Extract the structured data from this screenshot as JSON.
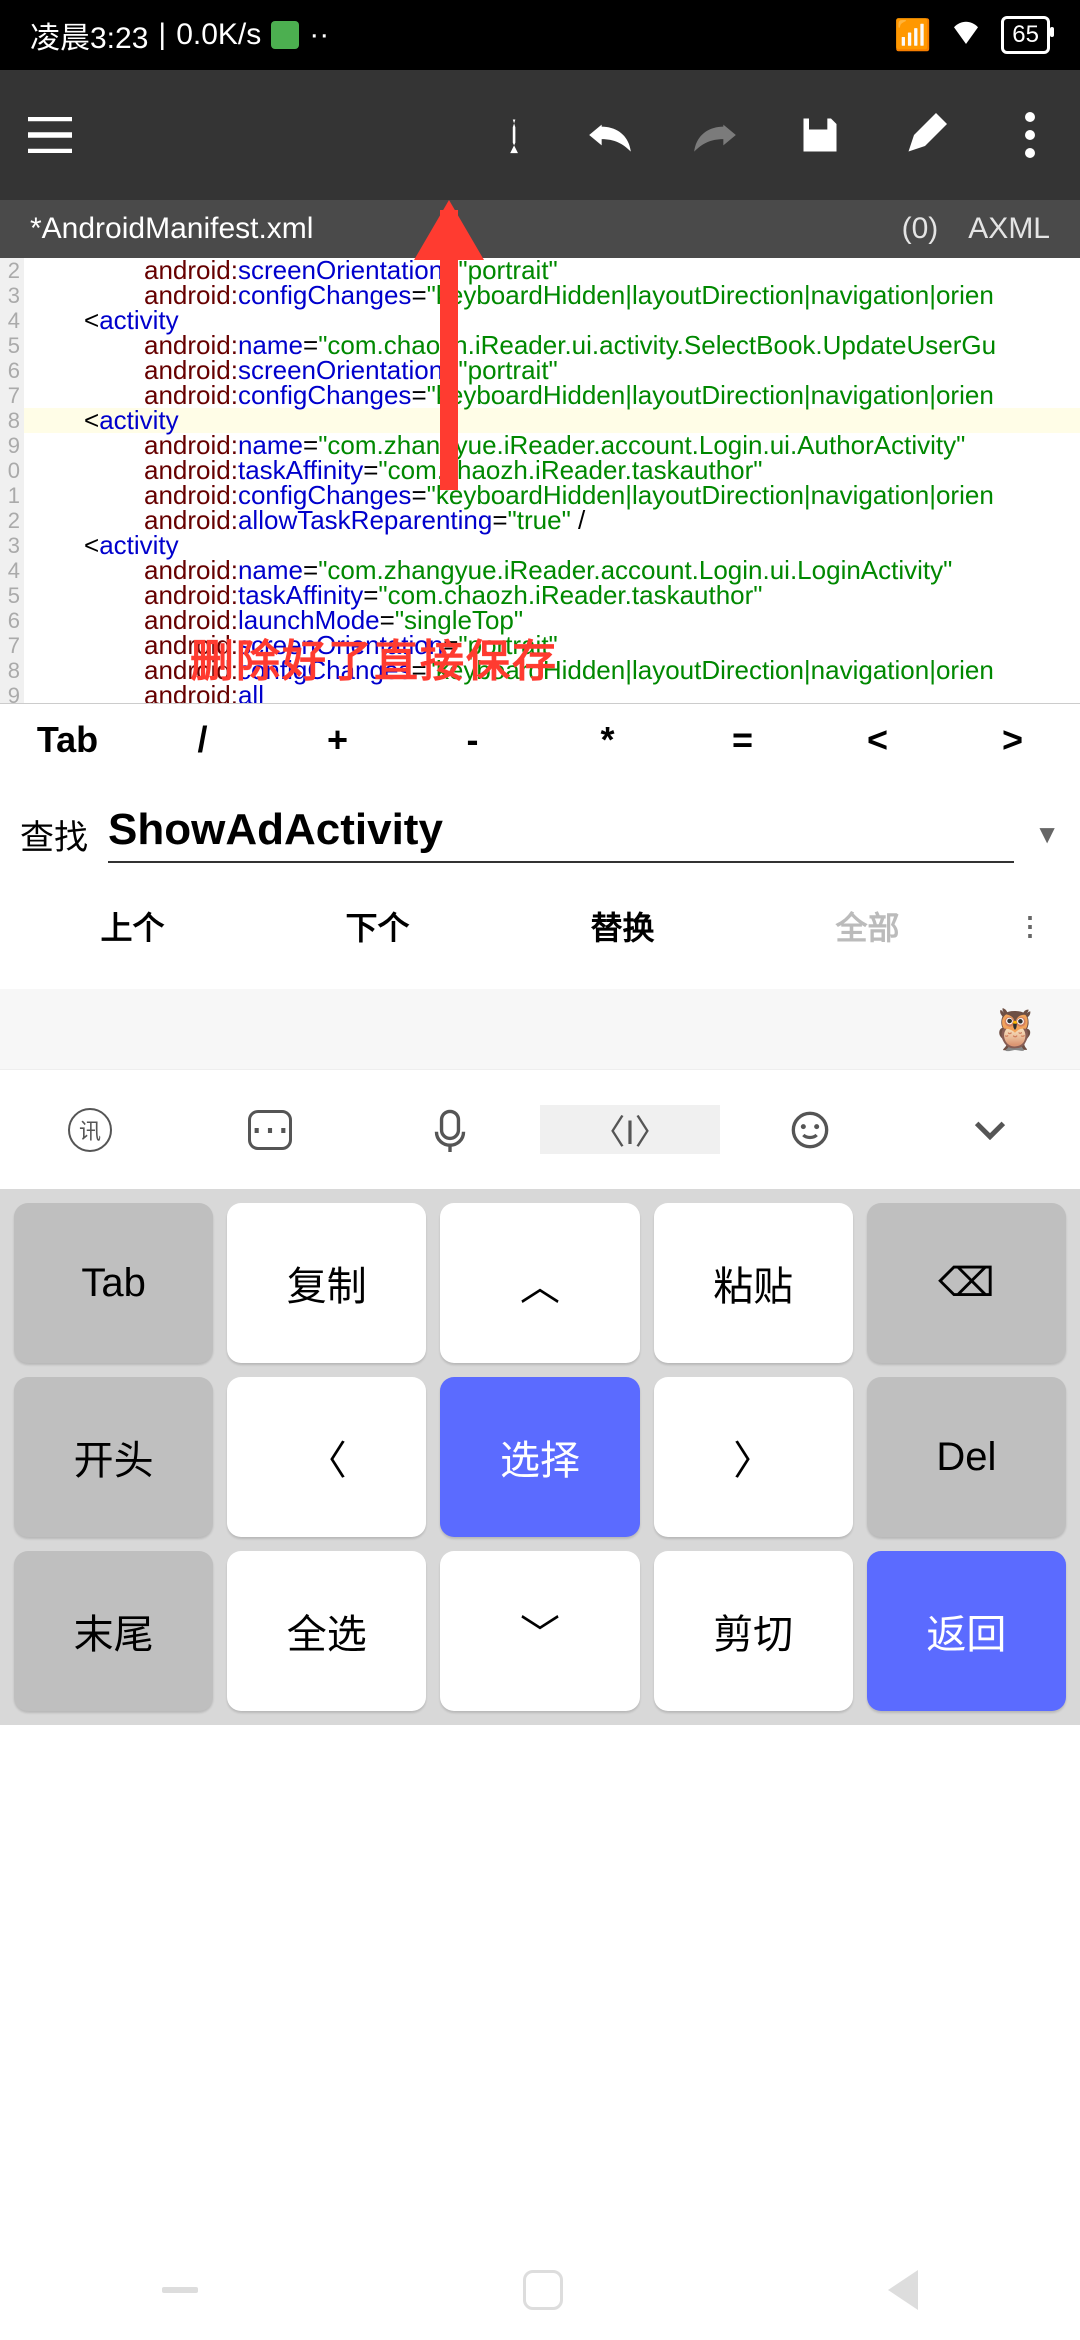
{
  "status": {
    "time_label": "凌晨3:23",
    "speed": "0.0K/s",
    "battery": "65"
  },
  "tab": {
    "filename": "*AndroidManifest.xml",
    "count": "(0)",
    "type": "AXML"
  },
  "gutter_lines": [
    "2",
    "3",
    "4",
    "5",
    "6",
    "7",
    "8",
    "9",
    "0",
    "1",
    "2",
    "3",
    "4",
    "5",
    "6",
    "7",
    "8",
    "9"
  ],
  "code": [
    {
      "indent": true,
      "spans": [
        {
          "c": "brown",
          "t": "android:"
        },
        {
          "c": "blue",
          "t": "screenOrientation"
        },
        {
          "c": "",
          "t": "="
        },
        {
          "c": "green",
          "t": "\"portrait\""
        }
      ]
    },
    {
      "indent": true,
      "spans": [
        {
          "c": "brown",
          "t": "android:"
        },
        {
          "c": "blue",
          "t": "configChanges"
        },
        {
          "c": "",
          "t": "="
        },
        {
          "c": "green",
          "t": "\"keyboardHidden|layoutDirection|navigation|orien"
        }
      ]
    },
    {
      "indent": false,
      "spans": [
        {
          "c": "",
          "t": "<"
        },
        {
          "c": "blue",
          "t": "activity"
        }
      ]
    },
    {
      "indent": true,
      "spans": [
        {
          "c": "brown",
          "t": "android:"
        },
        {
          "c": "blue",
          "t": "name"
        },
        {
          "c": "",
          "t": "="
        },
        {
          "c": "green",
          "t": "\"com.chaozh.iReader.ui.activity.SelectBook.UpdateUserGu"
        }
      ]
    },
    {
      "indent": true,
      "spans": [
        {
          "c": "brown",
          "t": "android:"
        },
        {
          "c": "blue",
          "t": "screenOrientation"
        },
        {
          "c": "",
          "t": "="
        },
        {
          "c": "green",
          "t": "\"portrait\""
        }
      ]
    },
    {
      "indent": true,
      "spans": [
        {
          "c": "brown",
          "t": "android:"
        },
        {
          "c": "blue",
          "t": "configChanges"
        },
        {
          "c": "",
          "t": "="
        },
        {
          "c": "green",
          "t": "\"keyboardHidden|layoutDirection|navigation|orien"
        }
      ]
    },
    {
      "indent": false,
      "hl": true,
      "spans": [
        {
          "c": "",
          "t": "<"
        },
        {
          "c": "blue",
          "t": "activity"
        }
      ]
    },
    {
      "indent": true,
      "spans": [
        {
          "c": "brown",
          "t": "android:"
        },
        {
          "c": "blue",
          "t": "name"
        },
        {
          "c": "",
          "t": "="
        },
        {
          "c": "green",
          "t": "\"com.zhangyue.iReader.account.Login.ui.AuthorActivity\""
        }
      ]
    },
    {
      "indent": true,
      "spans": [
        {
          "c": "brown",
          "t": "android:"
        },
        {
          "c": "blue",
          "t": "taskAffinity"
        },
        {
          "c": "",
          "t": "="
        },
        {
          "c": "green",
          "t": "\"com.chaozh.iReader.taskauthor\""
        }
      ]
    },
    {
      "indent": true,
      "spans": [
        {
          "c": "brown",
          "t": "android:"
        },
        {
          "c": "blue",
          "t": "configChanges"
        },
        {
          "c": "",
          "t": "="
        },
        {
          "c": "green",
          "t": "\"keyboardHidden|layoutDirection|navigation|orien"
        }
      ]
    },
    {
      "indent": true,
      "spans": [
        {
          "c": "brown",
          "t": "android:"
        },
        {
          "c": "blue",
          "t": "allowTaskReparenting"
        },
        {
          "c": "",
          "t": "="
        },
        {
          "c": "green",
          "t": "\"true\""
        },
        {
          "c": "",
          "t": " /"
        }
      ]
    },
    {
      "indent": false,
      "spans": [
        {
          "c": "",
          "t": "<"
        },
        {
          "c": "blue",
          "t": "activity"
        }
      ]
    },
    {
      "indent": true,
      "spans": [
        {
          "c": "brown",
          "t": "android:"
        },
        {
          "c": "blue",
          "t": "name"
        },
        {
          "c": "",
          "t": "="
        },
        {
          "c": "green",
          "t": "\"com.zhangyue.iReader.account.Login.ui.LoginActivity\""
        }
      ]
    },
    {
      "indent": true,
      "spans": [
        {
          "c": "brown",
          "t": "android:"
        },
        {
          "c": "blue",
          "t": "taskAffinity"
        },
        {
          "c": "",
          "t": "="
        },
        {
          "c": "green",
          "t": "\"com.chaozh.iReader.taskauthor\""
        }
      ]
    },
    {
      "indent": true,
      "spans": [
        {
          "c": "brown",
          "t": "android:"
        },
        {
          "c": "blue",
          "t": "launchMode"
        },
        {
          "c": "",
          "t": "="
        },
        {
          "c": "green",
          "t": "\"singleTop\""
        }
      ]
    },
    {
      "indent": true,
      "spans": [
        {
          "c": "brown",
          "t": "android:"
        },
        {
          "c": "blue",
          "t": "screenOrientation"
        },
        {
          "c": "",
          "t": "="
        },
        {
          "c": "green",
          "t": "\"portrait\""
        }
      ]
    },
    {
      "indent": true,
      "spans": [
        {
          "c": "brown",
          "t": "android:"
        },
        {
          "c": "blue",
          "t": "configChanges"
        },
        {
          "c": "",
          "t": "="
        },
        {
          "c": "green",
          "t": "\"keyboardHidden|layoutDirection|navigation|orien"
        }
      ]
    },
    {
      "indent": true,
      "spans": [
        {
          "c": "brown",
          "t": "android:"
        },
        {
          "c": "blue",
          "t": "all"
        }
      ]
    }
  ],
  "symbols": [
    "Tab",
    "/",
    "+",
    "-",
    "*",
    "=",
    "<",
    ">"
  ],
  "search": {
    "label": "查找",
    "value": "ShowAdActivity"
  },
  "find": {
    "prev": "上个",
    "next": "下个",
    "replace": "替换",
    "all": "全部"
  },
  "emoji": "🦉",
  "kb_top_icons": [
    "讯",
    "⌨",
    "🎤",
    "⟨I⟩",
    "☺",
    "⌄"
  ],
  "keys": [
    {
      "t": "Tab",
      "c": "gray"
    },
    {
      "t": "复制",
      "c": ""
    },
    {
      "t": "︿",
      "c": ""
    },
    {
      "t": "粘贴",
      "c": ""
    },
    {
      "t": "⌫",
      "c": "gray"
    },
    {
      "t": "开头",
      "c": "gray"
    },
    {
      "t": "〈",
      "c": ""
    },
    {
      "t": "选择",
      "c": "blue"
    },
    {
      "t": "〉",
      "c": ""
    },
    {
      "t": "Del",
      "c": "gray"
    },
    {
      "t": "末尾",
      "c": "gray"
    },
    {
      "t": "全选",
      "c": ""
    },
    {
      "t": "﹀",
      "c": ""
    },
    {
      "t": "剪切",
      "c": ""
    },
    {
      "t": "返回",
      "c": "blue"
    }
  ],
  "annotation": "删除好了直接保存"
}
